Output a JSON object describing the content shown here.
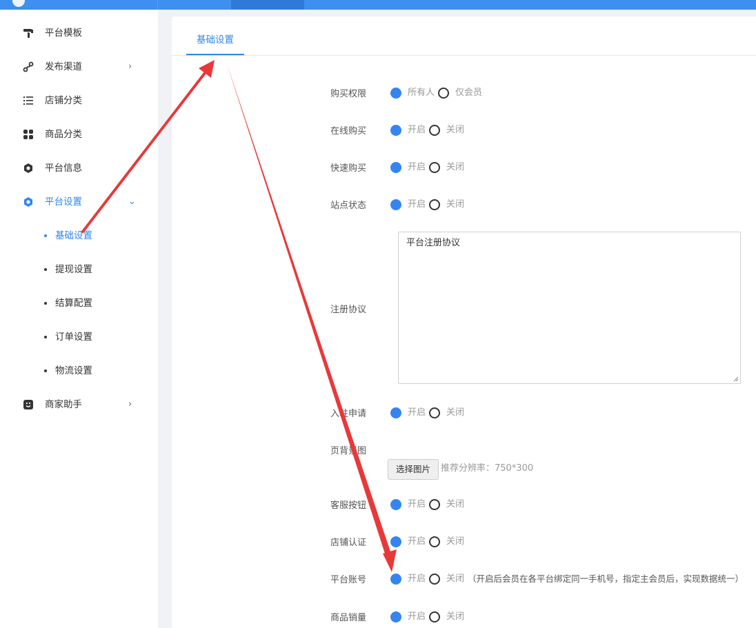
{
  "sidebar": {
    "items": [
      {
        "label": "平台模板",
        "icon": "paint-roller-icon"
      },
      {
        "label": "发布渠道",
        "icon": "share-link-icon",
        "arrow": "›"
      },
      {
        "label": "店铺分类",
        "icon": "list-icon"
      },
      {
        "label": "商品分类",
        "icon": "grid-icon"
      },
      {
        "label": "平台信息",
        "icon": "gear-icon"
      },
      {
        "label": "平台设置",
        "icon": "gear-icon",
        "arrow": "⌄",
        "active": true
      },
      {
        "label": "商家助手",
        "icon": "assistant-icon",
        "arrow": "›"
      }
    ],
    "sub_items": [
      {
        "label": "基础设置",
        "active": true
      },
      {
        "label": "提现设置"
      },
      {
        "label": "结算配置"
      },
      {
        "label": "订单设置"
      },
      {
        "label": "物流设置"
      }
    ]
  },
  "tabs": [
    {
      "label": "基础设置",
      "active": true
    }
  ],
  "form": {
    "purchase": {
      "label": "购买权限",
      "opt_a": "所有人",
      "opt_b": "仅会员",
      "value": "所有人"
    },
    "online_buy": {
      "label": "在线购买",
      "opt_a": "开启",
      "opt_b": "关闭",
      "value": "开启"
    },
    "quick_buy": {
      "label": "快速购买",
      "opt_a": "开启",
      "opt_b": "关闭",
      "value": "开启"
    },
    "site_status": {
      "label": "站点状态",
      "opt_a": "开启",
      "opt_b": "关闭",
      "value": "开启"
    },
    "agreement": {
      "label": "注册协议",
      "value": "平台注册协议"
    },
    "join_apply": {
      "label": "入驻申请",
      "opt_a": "开启",
      "opt_b": "关闭",
      "value": "开启"
    },
    "bg_image": {
      "label": "页背景图",
      "button": "选择图片",
      "hint": "推荐分辨率：750*300"
    },
    "service_btn": {
      "label": "客服按钮",
      "opt_a": "开启",
      "opt_b": "关闭",
      "value": "开启"
    },
    "shop_verify": {
      "label": "店铺认证",
      "opt_a": "开启",
      "opt_b": "关闭",
      "value": "开启"
    },
    "platform_account": {
      "label": "平台账号",
      "opt_a": "开启",
      "opt_b": "关闭",
      "value": "开启",
      "hint": "（开启后会员在各平台绑定同一手机号，指定主会员后，实现数据统一）"
    },
    "sales_count": {
      "label": "商品销量",
      "opt_a": "开启",
      "opt_b": "关闭",
      "value": "开启"
    }
  },
  "colors": {
    "accent": "#2f86f0",
    "annotation_arrow": "#e8393a"
  }
}
